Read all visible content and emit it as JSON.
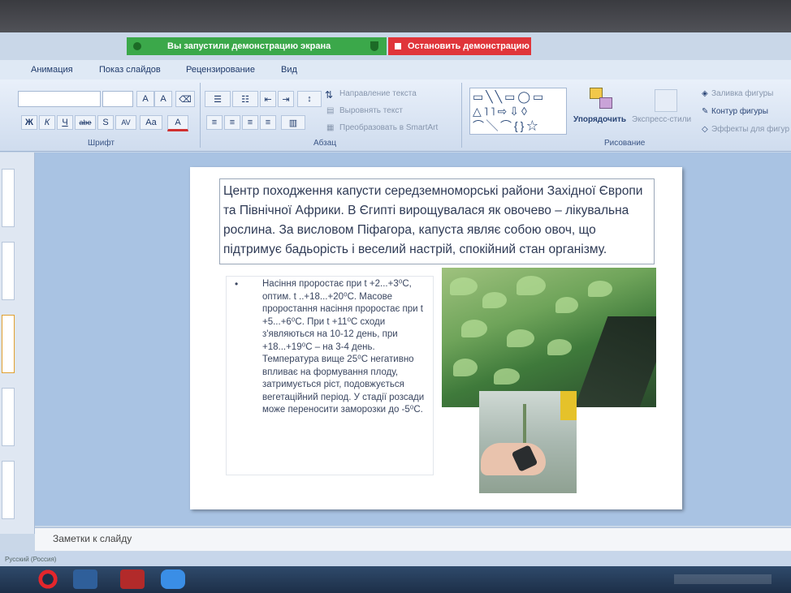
{
  "share_bar": {
    "status": "Вы запустили демонстрацию экрана",
    "stop_label": "Остановить демонстрацию"
  },
  "ribbon": {
    "tabs": [
      "Анимация",
      "Показ слайдов",
      "Рецензирование",
      "Вид"
    ],
    "font_group": {
      "label": "Шрифт",
      "buttons": [
        "Ж",
        "К",
        "Ч",
        "abe",
        "S",
        "AV",
        "Aa",
        "A"
      ]
    },
    "paragraph_group": {
      "label": "Абзац",
      "text_direction": "Направление текста",
      "align_text": "Выровнять текст",
      "convert_smartart": "Преобразовать в SmartArt"
    },
    "drawing_group": {
      "label": "Рисование",
      "arrange": "Упорядочить",
      "quick_styles": "Экспресс-стили",
      "shape_fill": "Заливка фигуры",
      "shape_outline": "Контур фигуры",
      "shape_effects": "Эффекты для фигур"
    }
  },
  "slide": {
    "title": "Центр походження капусти середземноморські райони Західної Європи та Північної Африки. В Єгипті вирощувалася як овочево – лікувальна рослина. За висловом Піфагора, капуста являє собою овоч, що підтримує бадьорість і веселий настрій, спокійний стан організму.",
    "bullet_marker": "•",
    "bullet": "Насіння проростає при t +2...+3⁰С, оптим. t ..+18...+20⁰С. Масове проростання насіння проростає при t +5...+6⁰С.  При t +11⁰С сходи з'являються на 10-12 день, при +18...+19⁰С – на 3-4 день. Температура вище 25⁰С негативно впливає на формування плоду, затримується ріст, подовжується вегетаційний період. У стадії розсади може переносити заморозки до -5⁰С."
  },
  "notes": {
    "placeholder": "Заметки к слайду"
  },
  "status_bar": {
    "language": "Русский (Россия)"
  },
  "colors": {
    "share_green": "#3ba84a",
    "share_red": "#e0353a",
    "workspace": "#a9c3e3"
  }
}
